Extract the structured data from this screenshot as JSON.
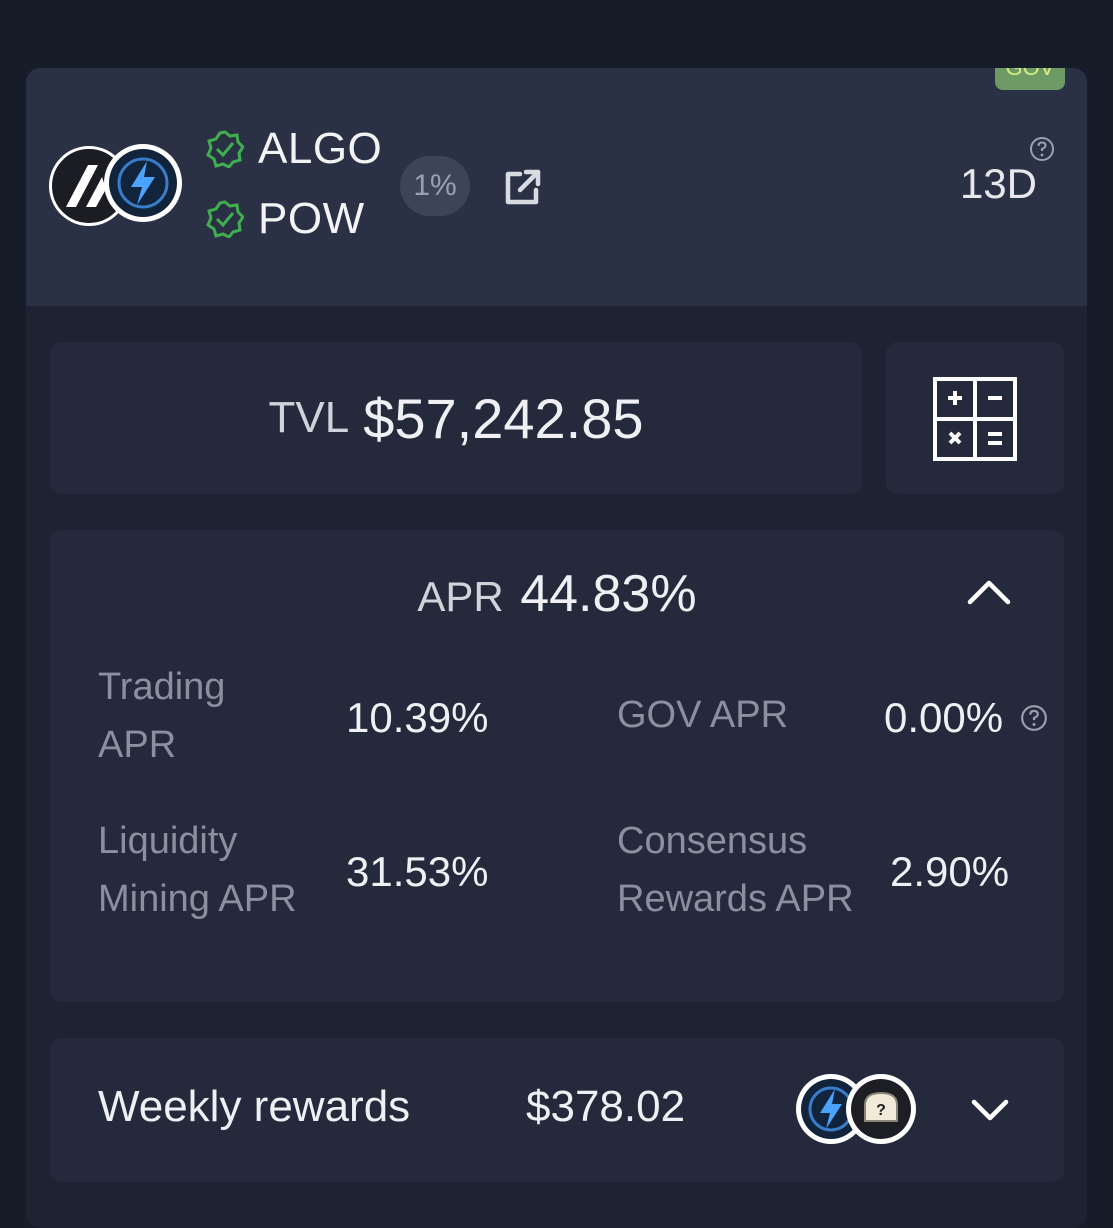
{
  "colors": {
    "background": "#171c29",
    "card": "#1e2333",
    "card_header": "#2b3144",
    "panel": "#242a3b",
    "verified_green": "#3fae4f",
    "gov_badge": "#6e9a66",
    "gov_badge_text": "#d5ee7e",
    "label_gray": "#8a90a0"
  },
  "pool": {
    "badge": "GOV",
    "token_a": {
      "symbol": "ALGO",
      "icon": "algorand-logo-icon",
      "verified_icon": "verified-badge-icon"
    },
    "token_b": {
      "symbol": "POW",
      "icon": "lightning-bolt-icon",
      "verified_icon": "verified-badge-icon"
    },
    "fee": "1%",
    "external_link_icon": "external-link-icon",
    "help_icon": "question-circle-icon",
    "age": "13D"
  },
  "tvl": {
    "label": "TVL",
    "value": "$57,242.85",
    "calculator_icon": "calculator-icon"
  },
  "apr": {
    "label": "APR",
    "value": "44.83%",
    "toggle_icon": "chevron-up-icon",
    "trading": {
      "label_line1": "Trading",
      "label_line2": "APR",
      "value": "10.39%"
    },
    "gov": {
      "label": "GOV APR",
      "value": "0.00%",
      "help_icon": "question-circle-icon"
    },
    "liquidity": {
      "label_line1": "Liquidity",
      "label_line2": "Mining APR",
      "value": "31.53%"
    },
    "consensus": {
      "label_line1": "Consensus",
      "label_line2": "Rewards APR",
      "value": "2.90%"
    }
  },
  "weekly_rewards": {
    "label": "Weekly rewards",
    "value": "$378.02",
    "reward_token_icons": [
      "lightning-bolt-icon",
      "unknown-token-icon"
    ],
    "toggle_icon": "chevron-down-icon"
  }
}
